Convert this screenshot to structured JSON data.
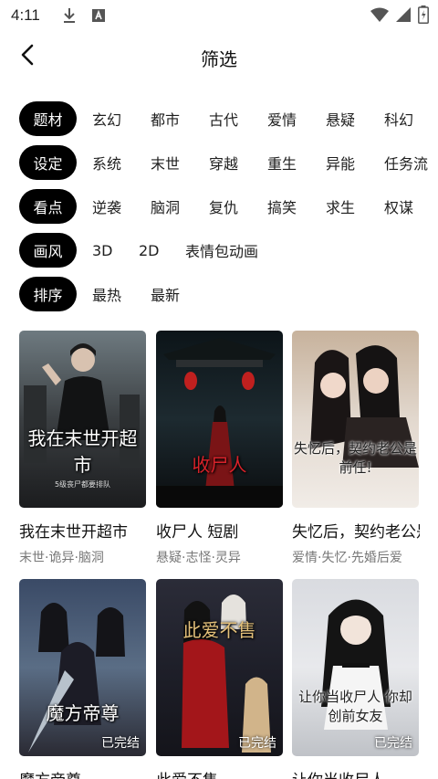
{
  "status_bar": {
    "time": "4:11",
    "icons": [
      "download-icon",
      "a-notification-icon",
      "wifi-icon",
      "cellular-signal-icon",
      "battery-charging-icon"
    ]
  },
  "header": {
    "title": "筛选",
    "back_icon": "back-chevron-icon"
  },
  "filters": [
    {
      "label": "题材",
      "options": [
        "玄幻",
        "都市",
        "古代",
        "爱情",
        "悬疑",
        "科幻"
      ]
    },
    {
      "label": "设定",
      "options": [
        "系统",
        "末世",
        "穿越",
        "重生",
        "异能",
        "任务流"
      ]
    },
    {
      "label": "看点",
      "options": [
        "逆袭",
        "脑洞",
        "复仇",
        "搞笑",
        "求生",
        "权谋"
      ]
    },
    {
      "label": "画风",
      "options": [
        "3D",
        "2D",
        "表情包动画"
      ]
    },
    {
      "label": "排序",
      "options": [
        "最热",
        "最新"
      ]
    }
  ],
  "comics": [
    {
      "title": "我在末世开超市",
      "tags": "末世·诡异·脑洞",
      "cover_text": "我在末世开超市",
      "cover_sub": "5级丧尸都要排队",
      "badge": ""
    },
    {
      "title": "收尸人  短剧",
      "tags": "悬疑·志怪·灵异",
      "cover_text": "收尸人",
      "cover_sub": "",
      "badge": ""
    },
    {
      "title": "失忆后，契约老公是前任",
      "tags": "爱情·失忆·先婚后爱",
      "cover_text": "失忆后，契约老公是前任!",
      "cover_sub": "",
      "badge": ""
    },
    {
      "title": "魔方帝尊",
      "tags": "",
      "cover_text": "魔方帝尊",
      "cover_sub": "",
      "badge": "已完结"
    },
    {
      "title": "此爱不售",
      "tags": "",
      "cover_text": "此爱不售",
      "cover_sub": "",
      "badge": "已完结"
    },
    {
      "title": "让你当收尸人",
      "tags": "",
      "cover_text": "让你当收尸人 你却创前女友",
      "cover_sub": "",
      "badge": "已完结"
    }
  ],
  "colors": {
    "label_bg": "#000000",
    "label_text": "#ffffff",
    "tag_text": "#777777"
  }
}
